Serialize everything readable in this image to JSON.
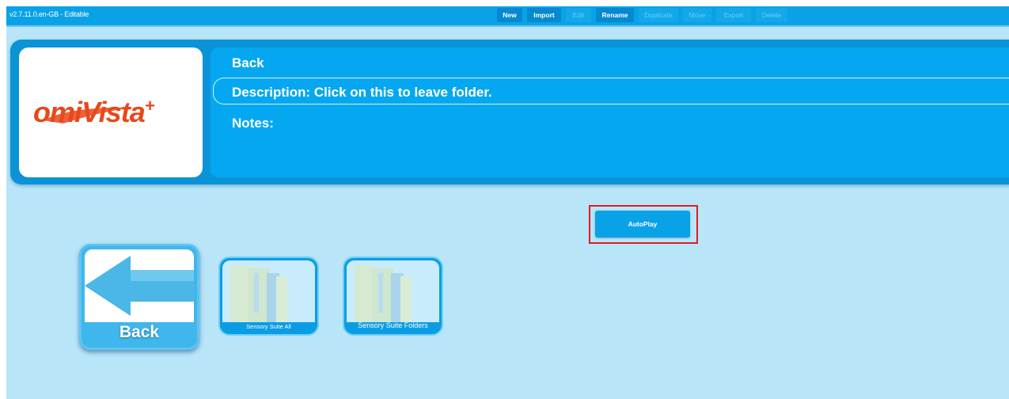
{
  "app": {
    "version": "v2.7.11.0.en-GB - Editable"
  },
  "toolbar": {
    "buttons": [
      {
        "label": "New",
        "enabled": true
      },
      {
        "label": "Import",
        "enabled": true
      },
      {
        "label": "Edit",
        "enabled": false
      },
      {
        "label": "Rename",
        "enabled": true
      },
      {
        "label": "Duplicate",
        "enabled": false
      },
      {
        "label": "Move",
        "enabled": false
      },
      {
        "label": "Export",
        "enabled": false
      },
      {
        "label": "Delete",
        "enabled": false
      }
    ]
  },
  "details": {
    "logo_text": "omiVista",
    "logo_plus": "+",
    "title": "Back",
    "description": "Description: Click on this to leave folder.",
    "notes": "Notes:"
  },
  "autoplay": {
    "label": "AutoPlay"
  },
  "tiles": [
    {
      "label": "Back",
      "icon": "back-arrow-icon"
    },
    {
      "label": "Sensory Suite All",
      "icon": "folder-icon"
    },
    {
      "label": "Sensory Suite Folders",
      "icon": "folder-icon"
    }
  ],
  "colors": {
    "background": "#b9e5f8",
    "toolbar": "#0aa2e6",
    "panel": "#0b93d8",
    "highlight": "#e11b22",
    "logo_brand": "#e8481a"
  }
}
